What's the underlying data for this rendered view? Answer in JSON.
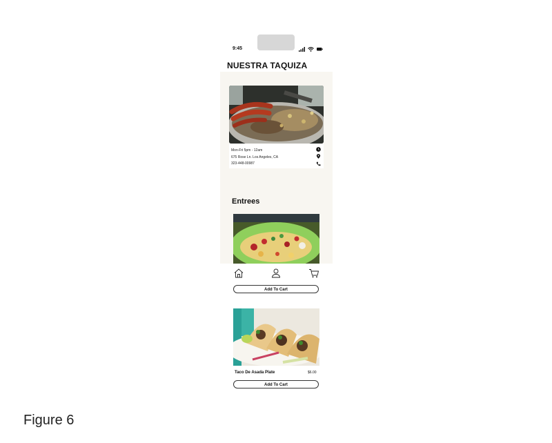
{
  "status": {
    "time": "9:45"
  },
  "app": {
    "title": "NUESTRA TAQUIZA"
  },
  "info": {
    "hours": "Mon-Fri 5pm - 12am",
    "address": "675 Rose Ln. Los Angeles, CA",
    "phone": "323-448-00987"
  },
  "section": {
    "title": "Entrees"
  },
  "items": [
    {
      "cart_label": "Add To Cart"
    },
    {
      "name": "Taco De Asada Plate",
      "price": "$6.00",
      "cart_label": "Add To Cart"
    }
  ],
  "nav": {
    "icons": [
      "home-icon",
      "profile-icon",
      "cart-icon"
    ]
  },
  "caption": "Figure 6"
}
